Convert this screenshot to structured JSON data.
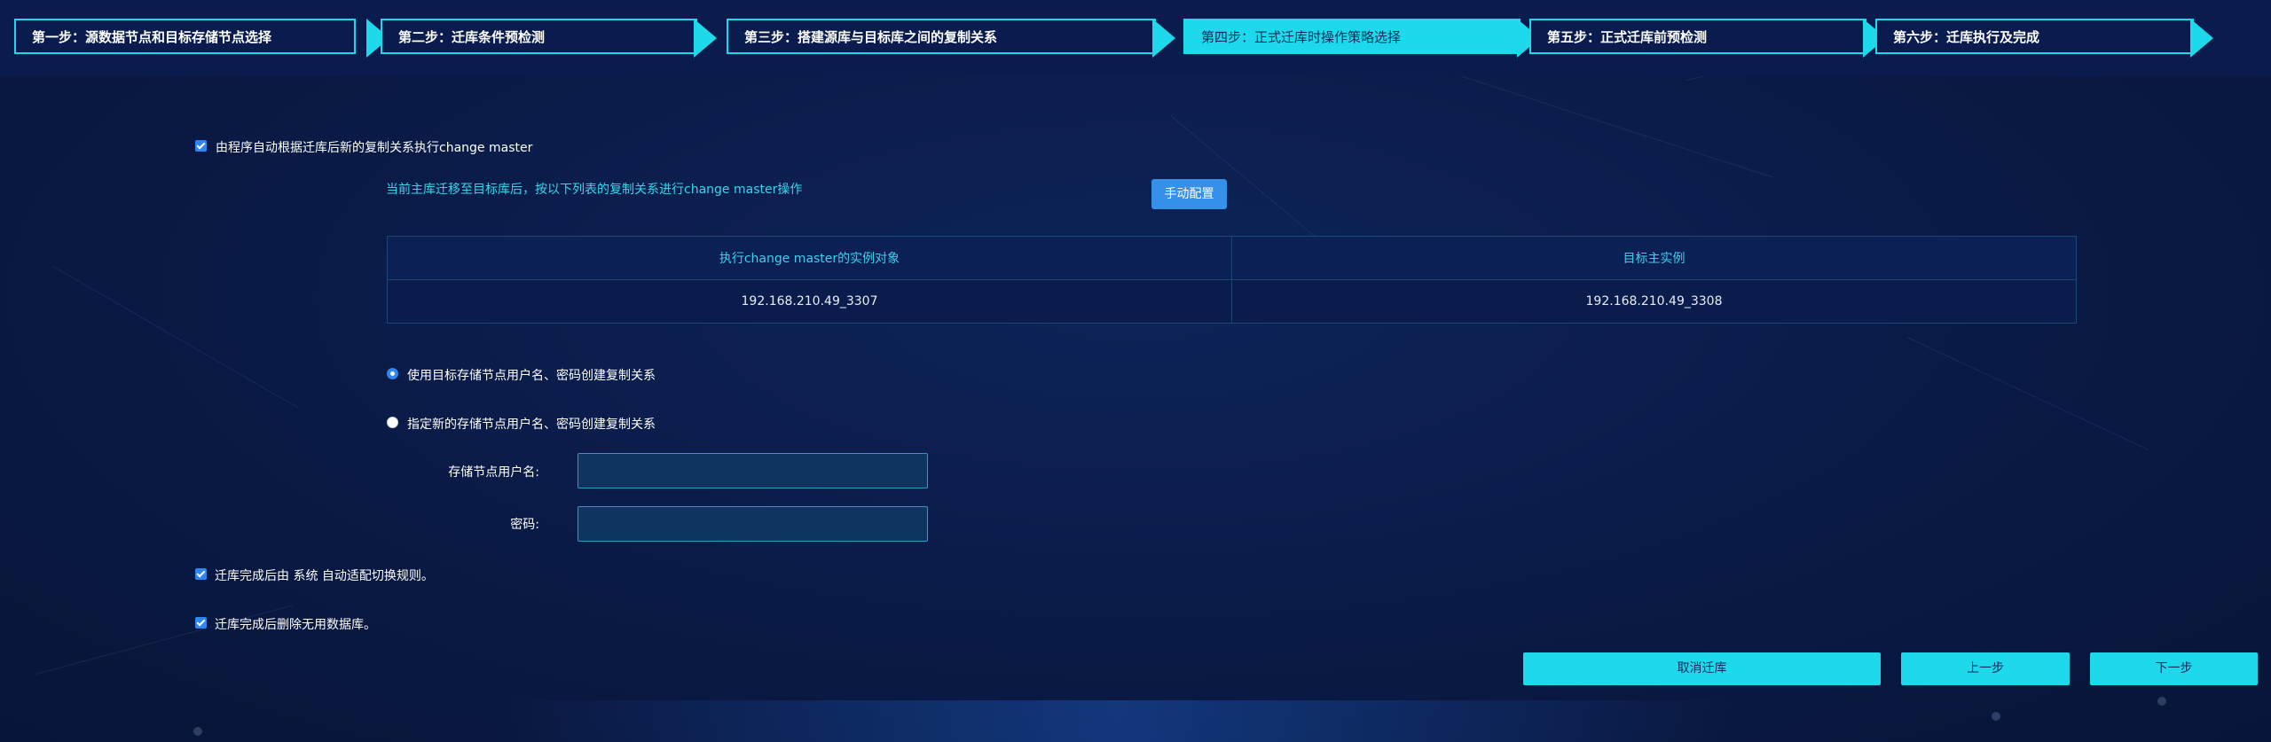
{
  "steps": [
    {
      "label": "第一步：源数据节点和目标存储节点选择"
    },
    {
      "label": "第二步：迁库条件预检测"
    },
    {
      "label": "第三步：搭建源库与目标库之间的复制关系"
    },
    {
      "label": "第四步：正式迁库时操作策略选择"
    },
    {
      "label": "第五步：正式迁库前预检测"
    },
    {
      "label": "第六步：迁库执行及完成"
    }
  ],
  "active_step": 4,
  "auto_change_master": {
    "label": "由程序自动根据迁库后新的复制关系执行change master",
    "checked": true
  },
  "hint_text": "当前主库迁移至目标库后，按以下列表的复制关系进行change master操作",
  "manual_config_button": "手动配置",
  "table": {
    "headers": [
      "执行change master的实例对象",
      "目标主实例"
    ],
    "rows": [
      [
        "192.168.210.49_3307",
        "192.168.210.49_3308"
      ]
    ]
  },
  "radio_options": [
    {
      "label": "使用目标存储节点用户名、密码创建复制关系",
      "selected": true
    },
    {
      "label": "指定新的存储节点用户名、密码创建复制关系",
      "selected": false
    }
  ],
  "form": {
    "username_label": "存储节点用户名:",
    "username_value": "",
    "password_label": "密码:",
    "password_value": ""
  },
  "options": [
    {
      "label": "迁库完成后由 系统 自动适配切换规则。",
      "checked": true
    },
    {
      "label": "迁库完成后删除无用数据库。",
      "checked": true
    }
  ],
  "actions": {
    "cancel": "取消迁库",
    "prev": "上一步",
    "next": "下一步"
  },
  "colors": {
    "accent": "#1ed8ec",
    "primary_button": "#3490e8",
    "hint_text": "#35d7ee",
    "background": "#0b1a45"
  }
}
